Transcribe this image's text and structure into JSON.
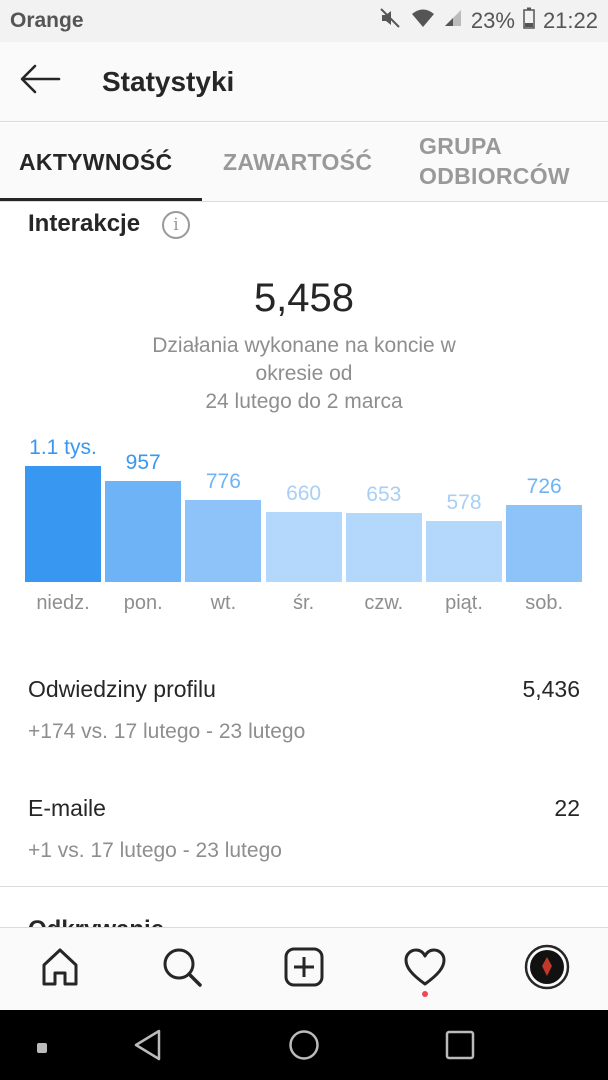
{
  "status_bar": {
    "carrier": "Orange",
    "battery": "23%",
    "time": "21:22",
    "icons": [
      "mute-icon",
      "wifi-icon",
      "signal-icon",
      "battery-icon"
    ]
  },
  "header": {
    "title": "Statystyki",
    "back_icon": "arrow-left-icon"
  },
  "tabs": [
    {
      "label": "AKTYWNOŚĆ",
      "active": true
    },
    {
      "label": "ZAWARTOŚĆ",
      "active": false
    },
    {
      "label_line1": "GRUPA",
      "label_line2": "ODBIORCÓW",
      "active": false
    }
  ],
  "interactions": {
    "title": "Interakcje",
    "info_icon": "i",
    "total": "5,458",
    "description_line1": "Działania wykonane na koncie w",
    "description_line2": "okresie od",
    "description_line3": "24 lutego do 2 marca"
  },
  "chart_data": {
    "type": "bar",
    "categories": [
      "niedz.",
      "pon.",
      "wt.",
      "śr.",
      "czw.",
      "piąt.",
      "sob."
    ],
    "value_labels": [
      "1.1 tys.",
      "957",
      "776",
      "660",
      "653",
      "578",
      "726"
    ],
    "values": [
      1100,
      957,
      776,
      660,
      653,
      578,
      726
    ],
    "colors": [
      "#3897f0",
      "#6fb3f7",
      "#8dc3f8",
      "#b3d8fb",
      "#b3d8fb",
      "#b3d8fb",
      "#8dc3f8"
    ],
    "label_colors": [
      "#3897f0",
      "#3897f0",
      "#6fb3f7",
      "#a9cff5",
      "#a9cff5",
      "#a9cff5",
      "#6fb3f7"
    ],
    "ylim": [
      0,
      1100
    ],
    "grid": false
  },
  "stats": [
    {
      "label": "Odwiedziny profilu",
      "value": "5,436",
      "sub": "+174 vs. 17 lutego - 23 lutego"
    },
    {
      "label": "E-maile",
      "value": "22",
      "sub": "+1 vs. 17 lutego - 23 lutego"
    }
  ],
  "next_section": {
    "title": "Odkrywanie"
  },
  "bottom_nav": [
    "home-icon",
    "search-icon",
    "add-post-icon",
    "activity-heart-icon",
    "profile-avatar-icon"
  ],
  "android_nav": [
    "recent-dot-icon",
    "back-triangle-icon",
    "home-circle-icon",
    "overview-square-icon"
  ]
}
